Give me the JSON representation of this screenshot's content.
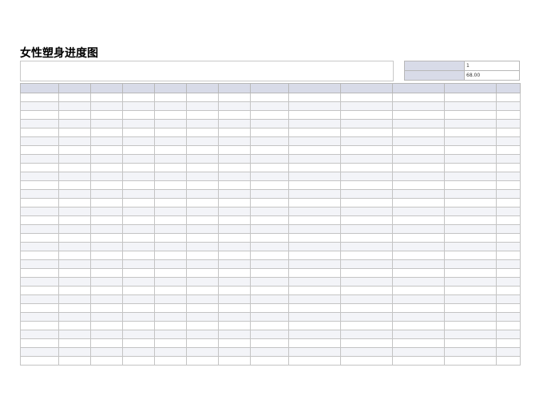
{
  "title": "女性塑身进度图",
  "note": {
    "label": "",
    "text": ""
  },
  "params": [
    {
      "label": "",
      "value": "1"
    },
    {
      "label": "",
      "value": "68.00"
    }
  ],
  "columns": [
    "",
    "",
    "",
    "",
    "",
    "",
    "",
    "",
    "",
    "",
    "",
    "",
    ""
  ],
  "rows": [
    [
      "",
      "",
      "",
      "",
      "",
      "",
      "",
      "",
      "",
      "",
      "",
      "",
      ""
    ],
    [
      "",
      "",
      "",
      "",
      "",
      "",
      "",
      "",
      "",
      "",
      "",
      "",
      ""
    ],
    [
      "",
      "",
      "",
      "",
      "",
      "",
      "",
      "",
      "",
      "",
      "",
      "",
      ""
    ],
    [
      "",
      "",
      "",
      "",
      "",
      "",
      "",
      "",
      "",
      "",
      "",
      "",
      ""
    ],
    [
      "",
      "",
      "",
      "",
      "",
      "",
      "",
      "",
      "",
      "",
      "",
      "",
      ""
    ],
    [
      "",
      "",
      "",
      "",
      "",
      "",
      "",
      "",
      "",
      "",
      "",
      "",
      ""
    ],
    [
      "",
      "",
      "",
      "",
      "",
      "",
      "",
      "",
      "",
      "",
      "",
      "",
      ""
    ],
    [
      "",
      "",
      "",
      "",
      "",
      "",
      "",
      "",
      "",
      "",
      "",
      "",
      ""
    ],
    [
      "",
      "",
      "",
      "",
      "",
      "",
      "",
      "",
      "",
      "",
      "",
      "",
      ""
    ],
    [
      "",
      "",
      "",
      "",
      "",
      "",
      "",
      "",
      "",
      "",
      "",
      "",
      ""
    ],
    [
      "",
      "",
      "",
      "",
      "",
      "",
      "",
      "",
      "",
      "",
      "",
      "",
      ""
    ],
    [
      "",
      "",
      "",
      "",
      "",
      "",
      "",
      "",
      "",
      "",
      "",
      "",
      ""
    ],
    [
      "",
      "",
      "",
      "",
      "",
      "",
      "",
      "",
      "",
      "",
      "",
      "",
      ""
    ],
    [
      "",
      "",
      "",
      "",
      "",
      "",
      "",
      "",
      "",
      "",
      "",
      "",
      ""
    ],
    [
      "",
      "",
      "",
      "",
      "",
      "",
      "",
      "",
      "",
      "",
      "",
      "",
      ""
    ],
    [
      "",
      "",
      "",
      "",
      "",
      "",
      "",
      "",
      "",
      "",
      "",
      "",
      ""
    ],
    [
      "",
      "",
      "",
      "",
      "",
      "",
      "",
      "",
      "",
      "",
      "",
      "",
      ""
    ],
    [
      "",
      "",
      "",
      "",
      "",
      "",
      "",
      "",
      "",
      "",
      "",
      "",
      ""
    ],
    [
      "",
      "",
      "",
      "",
      "",
      "",
      "",
      "",
      "",
      "",
      "",
      "",
      ""
    ],
    [
      "",
      "",
      "",
      "",
      "",
      "",
      "",
      "",
      "",
      "",
      "",
      "",
      ""
    ],
    [
      "",
      "",
      "",
      "",
      "",
      "",
      "",
      "",
      "",
      "",
      "",
      "",
      ""
    ],
    [
      "",
      "",
      "",
      "",
      "",
      "",
      "",
      "",
      "",
      "",
      "",
      "",
      ""
    ],
    [
      "",
      "",
      "",
      "",
      "",
      "",
      "",
      "",
      "",
      "",
      "",
      "",
      ""
    ],
    [
      "",
      "",
      "",
      "",
      "",
      "",
      "",
      "",
      "",
      "",
      "",
      "",
      ""
    ],
    [
      "",
      "",
      "",
      "",
      "",
      "",
      "",
      "",
      "",
      "",
      "",
      "",
      ""
    ],
    [
      "",
      "",
      "",
      "",
      "",
      "",
      "",
      "",
      "",
      "",
      "",
      "",
      ""
    ],
    [
      "",
      "",
      "",
      "",
      "",
      "",
      "",
      "",
      "",
      "",
      "",
      "",
      ""
    ],
    [
      "",
      "",
      "",
      "",
      "",
      "",
      "",
      "",
      "",
      "",
      "",
      "",
      ""
    ],
    [
      "",
      "",
      "",
      "",
      "",
      "",
      "",
      "",
      "",
      "",
      "",
      "",
      ""
    ],
    [
      "",
      "",
      "",
      "",
      "",
      "",
      "",
      "",
      "",
      "",
      "",
      "",
      ""
    ],
    [
      "",
      "",
      "",
      "",
      "",
      "",
      "",
      "",
      "",
      "",
      "",
      "",
      ""
    ]
  ]
}
